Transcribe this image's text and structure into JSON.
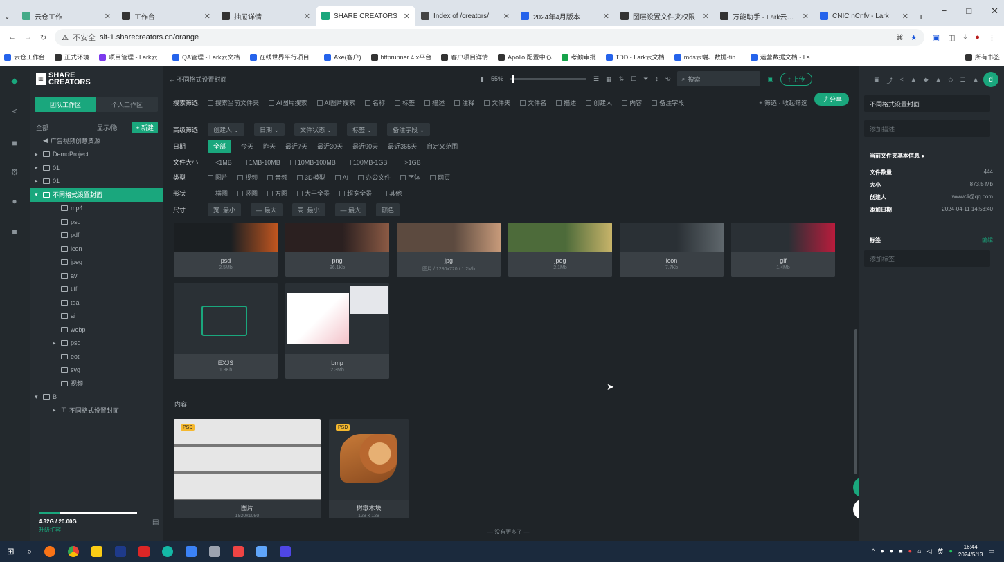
{
  "browser": {
    "tabs": [
      {
        "label": "云仓工作",
        "color": "#4a8"
      },
      {
        "label": "工作台",
        "color": "#333"
      },
      {
        "label": "抽屉详情",
        "color": "#333"
      },
      {
        "label": "SHARE CREATORS",
        "color": "#1aa77d"
      },
      {
        "label": "Index of /creators/",
        "color": "#444"
      },
      {
        "label": "2024年4月版本",
        "color": "#2563eb"
      },
      {
        "label": "图层设置文件夹权限",
        "color": "#333"
      },
      {
        "label": "万能助手 - Lark云文档",
        "color": "#333"
      },
      {
        "label": "CNIC nCnfv - Lark",
        "color": "#2563eb"
      }
    ],
    "window_controls": [
      "−",
      "□",
      "✕"
    ],
    "url_prefix": "不安全",
    "url": "sit-1.sharecreators.cn/orange",
    "bookmarks": [
      {
        "label": "云仓工作台",
        "color": "#2563eb"
      },
      {
        "label": "正式环境",
        "color": "#333"
      },
      {
        "label": "项目管理 - Lark云...",
        "color": "#7c3aed"
      },
      {
        "label": "QA管理 - Lark云文档",
        "color": "#2563eb"
      },
      {
        "label": "在线世界平行项目...",
        "color": "#2563eb"
      },
      {
        "label": "Axe(客户)",
        "color": "#2563eb"
      },
      {
        "label": "httprunner 4.x平台",
        "color": "#333"
      },
      {
        "label": "客户项目详情",
        "color": "#333"
      },
      {
        "label": "Apollo 配置中心",
        "color": "#333"
      },
      {
        "label": "考勤审批",
        "color": "#16a34a"
      },
      {
        "label": "TDD - Lark云文档",
        "color": "#2563eb"
      },
      {
        "label": "mds云端、数据-fin...",
        "color": "#2563eb"
      },
      {
        "label": "运营数据文档 - La...",
        "color": "#2563eb"
      },
      {
        "label": "所有书签",
        "color": "#333"
      }
    ]
  },
  "app": {
    "logo_line1": "SHARE",
    "logo_line2": "CREATORS",
    "workspace_tabs": [
      "团队工作区",
      "个人工作区"
    ],
    "tree_header": {
      "label": "全部",
      "action": "显示/隐",
      "new_button": "+ 新建"
    },
    "tree": [
      {
        "label": "广告视频创意资源",
        "indent": 1,
        "icon": "arrow"
      },
      {
        "label": "DemoProject",
        "indent": 1,
        "icon": "folder",
        "caret": "▸"
      },
      {
        "label": "01",
        "indent": 1,
        "icon": "folder",
        "caret": "▸"
      },
      {
        "label": "01",
        "indent": 1,
        "icon": "folder",
        "caret": "▸"
      },
      {
        "label": "不同格式设置封面",
        "indent": 1,
        "icon": "folder",
        "caret": "▾",
        "selected": true
      },
      {
        "label": "mp4",
        "indent": 2,
        "icon": "folder"
      },
      {
        "label": "psd",
        "indent": 2,
        "icon": "folder"
      },
      {
        "label": "pdf",
        "indent": 2,
        "icon": "folder"
      },
      {
        "label": "icon",
        "indent": 2,
        "icon": "folder"
      },
      {
        "label": "jpeg",
        "indent": 2,
        "icon": "folder"
      },
      {
        "label": "avi",
        "indent": 2,
        "icon": "folder"
      },
      {
        "label": "tiff",
        "indent": 2,
        "icon": "folder"
      },
      {
        "label": "tga",
        "indent": 2,
        "icon": "folder"
      },
      {
        "label": "ai",
        "indent": 2,
        "icon": "folder"
      },
      {
        "label": "webp",
        "indent": 2,
        "icon": "folder"
      },
      {
        "label": "psd",
        "indent": 2,
        "icon": "folder",
        "caret": "▸"
      },
      {
        "label": "eot",
        "indent": 2,
        "icon": "folder"
      },
      {
        "label": "svg",
        "indent": 2,
        "icon": "folder"
      },
      {
        "label": "视频",
        "indent": 2,
        "icon": "folder"
      },
      {
        "label": "B",
        "indent": 1,
        "icon": "folder",
        "caret": "▾"
      },
      {
        "label": "不同格式设置封面",
        "indent": 2,
        "icon": "link",
        "caret": "▸"
      }
    ],
    "storage": {
      "text": "4.32G / 20.00G",
      "sub": "升级扩容",
      "fraction": 0.22
    },
    "toolbar": {
      "breadcrumb": "← 不同格式设置封面",
      "zoom": "55%",
      "search_placeholder": "搜索",
      "upload": "上传"
    },
    "filters": {
      "row1_label": "搜索筛选:",
      "row1_items": [
        "搜索当前文件夹",
        "AI图片搜索",
        "AI图片搜索",
        "名称",
        "标签",
        "描述",
        "注释",
        "文件夹",
        "文件名",
        "描述",
        "创建人",
        "内容",
        "备注字段"
      ],
      "row1_extra": "+ 筛选 · 收起筛选",
      "share": "分享",
      "row2_label": "高级筛选",
      "row2_items": [
        "创建人 ⌄",
        "日期 ⌄",
        "文件状态 ⌄",
        "标签 ⌄",
        "备注字段 ⌄"
      ],
      "row3_label": "日期",
      "row3_items": [
        "全部",
        "今天",
        "昨天",
        "最近7天",
        "最近30天",
        "最近90天",
        "最近365天",
        "自定义范围"
      ],
      "row4_label": "文件大小",
      "row4_items": [
        "<1MB",
        "1MB-10MB",
        "10MB-100MB",
        "100MB-1GB",
        ">1GB"
      ],
      "row5_label": "类型",
      "row5_items": [
        "图片",
        "视频",
        "音频",
        "3D模型",
        "AI",
        "办公文件",
        "字体",
        "网页"
      ],
      "row6_label": "形状",
      "row6_items": [
        "横图",
        "竖图",
        "方图",
        "大于全景",
        "超宽全景",
        "其他"
      ],
      "row7_label": "尺寸",
      "row7_items": [
        "宽: 最小",
        "— 最大",
        "高: 最小",
        "— 最大",
        "颜色"
      ]
    },
    "cards_row1": [
      {
        "ext": "psd",
        "size": "2.5Mb"
      },
      {
        "ext": "png",
        "size": "96.1Kb"
      },
      {
        "ext": "jpg",
        "size": "图片 / 1280x720 / 1.2Mb"
      },
      {
        "ext": "jpeg",
        "size": "2.1Mb"
      },
      {
        "ext": "icon",
        "size": "7.7Kb"
      },
      {
        "ext": "gif",
        "size": "1.4Mb"
      }
    ],
    "cards_row2": [
      {
        "ext": "EXJS",
        "size": "1.3Kb"
      },
      {
        "ext": "bmp",
        "size": "2.3Mb"
      }
    ],
    "section_label": "内容",
    "cards_row3": [
      {
        "name": "图片",
        "size": "1920x1080",
        "badge": "PSD"
      },
      {
        "name": "树墩木块",
        "size": "128 x 128",
        "badge": "PSD"
      }
    ],
    "footer_hint": "没有更多了",
    "right": {
      "title": "不同格式设置封面",
      "desc_placeholder": "添加描述",
      "section": "当前文件夹基本信息",
      "info": [
        {
          "k": "文件数量",
          "v": "444"
        },
        {
          "k": "大小",
          "v": "873.5 Mb"
        },
        {
          "k": "创建人",
          "v": "wwwcli@qq.com"
        },
        {
          "k": "添加日期",
          "v": "2024-04-11 14:53:40"
        }
      ],
      "tags_label": "标签",
      "tags_action": "编辑",
      "tag_placeholder": "添加标签"
    }
  },
  "taskbar": {
    "time": "16:44",
    "date": "2024/5/13",
    "ime": "英"
  }
}
